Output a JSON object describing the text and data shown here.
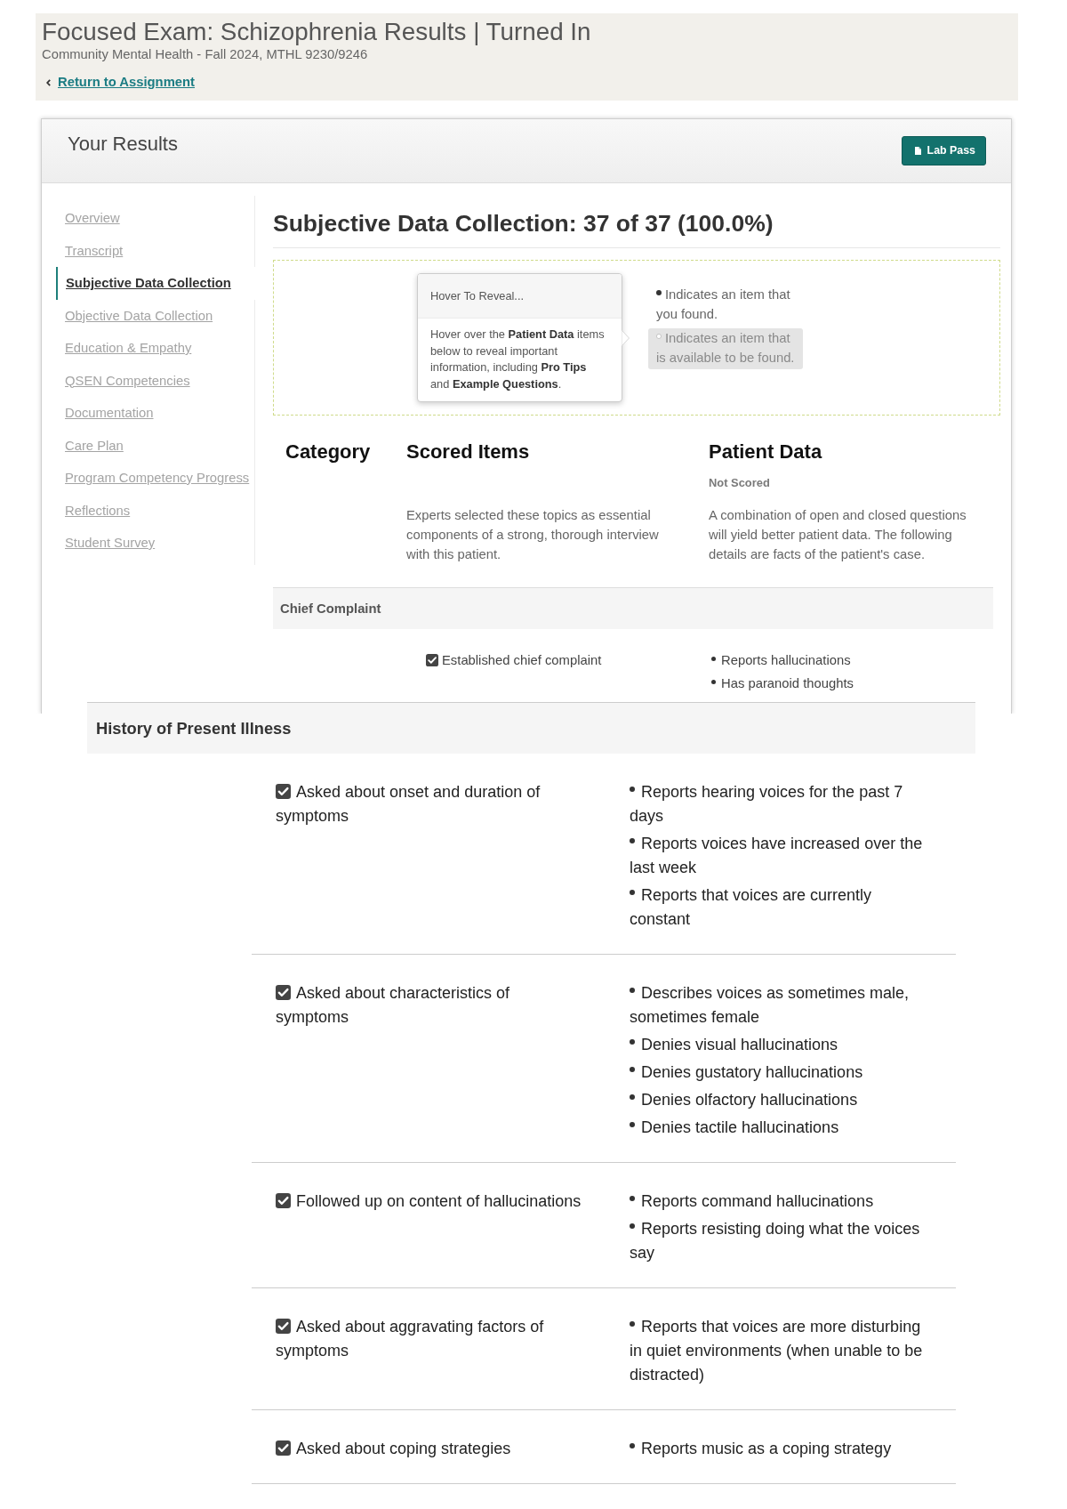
{
  "page_header": {
    "title": "Focused Exam: Schizophrenia Results | Turned In",
    "subtitle": "Community Mental Health - Fall 2024, MTHL 9230/9246",
    "back_link": "Return to Assignment"
  },
  "results_card": {
    "title": "Your Results",
    "lab_pass_button": "Lab Pass"
  },
  "sidebar": {
    "items": [
      {
        "label": "Overview",
        "selected": false
      },
      {
        "label": "Transcript",
        "selected": false
      },
      {
        "label": "Subjective Data Collection",
        "selected": true
      },
      {
        "label": "Objective Data Collection",
        "selected": false
      },
      {
        "label": "Education & Empathy",
        "selected": false
      },
      {
        "label": "QSEN Competencies",
        "selected": false
      },
      {
        "label": "Documentation",
        "selected": false
      },
      {
        "label": "Care Plan",
        "selected": false
      },
      {
        "label": "Program Competency Progress",
        "selected": false
      },
      {
        "label": "Reflections",
        "selected": false
      },
      {
        "label": "Student Survey",
        "selected": false
      }
    ]
  },
  "section": {
    "title": "Subjective Data Collection: 37 of 37 (100.0%)"
  },
  "legend": {
    "popover": {
      "title": "Hover To Reveal...",
      "body": "Hover over the **Patient Data** items below to reveal important information, including **Pro Tips** and **Example Questions**."
    },
    "items": [
      {
        "text": "Indicates an item that you found.",
        "found": true
      },
      {
        "text": "Indicates an item that is available to be found.",
        "found": false
      }
    ]
  },
  "table": {
    "columns": [
      {
        "title": "Category"
      },
      {
        "title": "Scored Items",
        "description": "Experts selected these topics as essential components of a strong, thorough interview with this patient."
      },
      {
        "title": "Patient Data",
        "note": "Not Scored",
        "description": "A combination of open and closed questions will yield better patient data. The following details are facts of the patient's case."
      }
    ],
    "groups": [
      {
        "category": "Chief Complaint",
        "rows": [
          {
            "scored_item": "Established chief complaint",
            "checked": true,
            "patient_data": [
              {
                "text": "Reports hallucinations",
                "found": true
              },
              {
                "text": "Has paranoid thoughts",
                "found": true
              }
            ]
          }
        ]
      }
    ]
  },
  "table_continued": {
    "groups": [
      {
        "category": "History of Present Illness",
        "rows": [
          {
            "scored_item": "Asked about onset and duration of symptoms",
            "checked": true,
            "patient_data": [
              {
                "text": "Reports hearing voices for the past 7 days",
                "found": true
              },
              {
                "text": "Reports voices have increased over the last week",
                "found": true
              },
              {
                "text": "Reports that voices are currently constant",
                "found": true
              }
            ]
          },
          {
            "scored_item": "Asked about characteristics of symptoms",
            "checked": true,
            "patient_data": [
              {
                "text": "Describes voices as sometimes male, sometimes female",
                "found": true
              },
              {
                "text": "Denies visual hallucinations",
                "found": true
              },
              {
                "text": "Denies gustatory hallucinations",
                "found": true
              },
              {
                "text": "Denies olfactory hallucinations",
                "found": true
              },
              {
                "text": "Denies tactile hallucinations",
                "found": true
              }
            ]
          },
          {
            "scored_item": "Followed up on content of hallucinations",
            "checked": true,
            "patient_data": [
              {
                "text": "Reports command hallucinations",
                "found": true
              },
              {
                "text": "Reports resisting doing what the voices say",
                "found": true
              }
            ]
          },
          {
            "scored_item": "Asked about aggravating factors of symptoms",
            "checked": true,
            "patient_data": [
              {
                "text": "Reports that voices are more disturbing in quiet environments (when unable to be distracted)",
                "found": true
              }
            ]
          },
          {
            "scored_item": "Asked about coping strategies",
            "checked": true,
            "patient_data": [
              {
                "text": "Reports music as a coping strategy",
                "found": true
              }
            ]
          }
        ]
      }
    ]
  }
}
